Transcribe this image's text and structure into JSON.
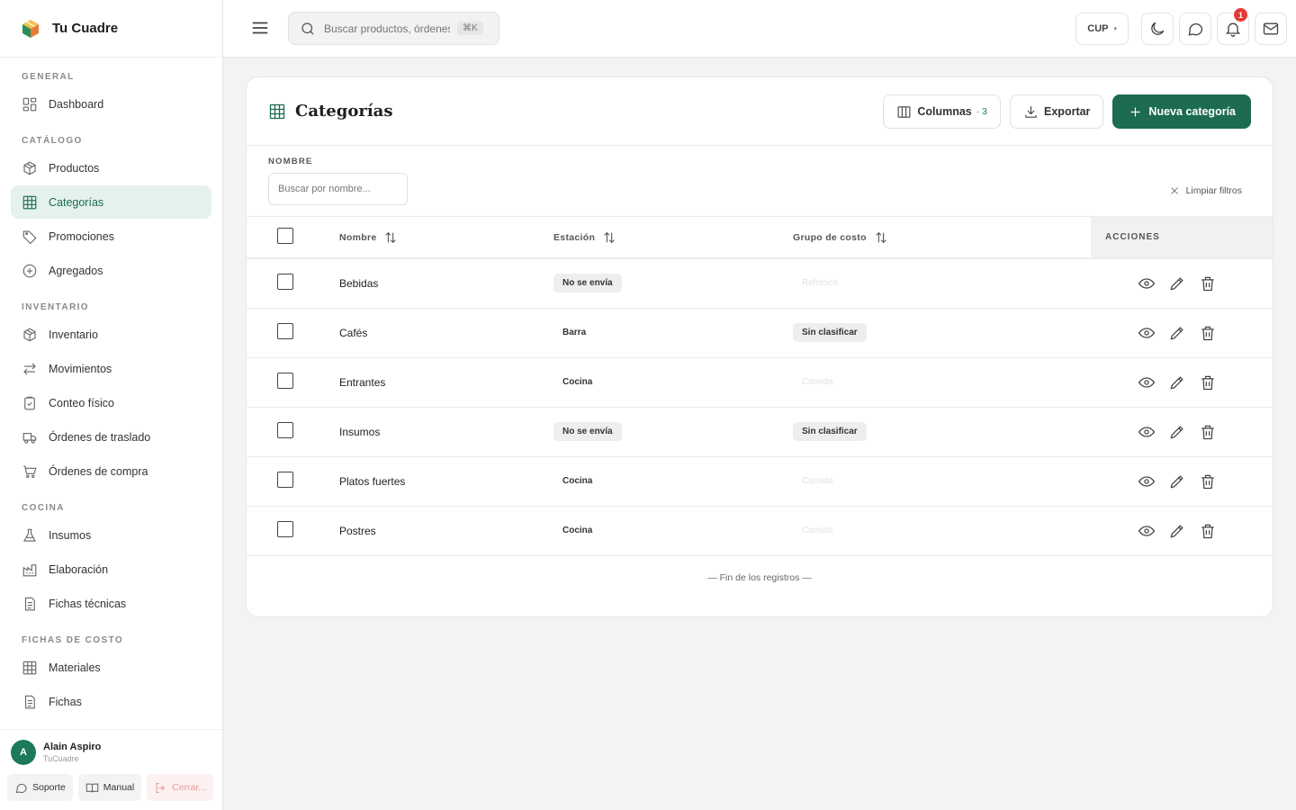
{
  "brand": {
    "name": "Tu Cuadre"
  },
  "sidebar": {
    "sections": [
      {
        "title": "GENERAL",
        "items": [
          {
            "label": "Dashboard",
            "icon": "dashboard-icon"
          }
        ]
      },
      {
        "title": "CATÁLOGO",
        "items": [
          {
            "label": "Productos",
            "icon": "box-icon"
          },
          {
            "label": "Categorías",
            "icon": "grid-icon",
            "active": true
          },
          {
            "label": "Promociones",
            "icon": "tag-icon"
          },
          {
            "label": "Agregados",
            "icon": "plus-circle-icon"
          }
        ]
      },
      {
        "title": "INVENTARIO",
        "items": [
          {
            "label": "Inventario",
            "icon": "box-icon"
          },
          {
            "label": "Movimientos",
            "icon": "arrows-icon"
          },
          {
            "label": "Conteo físico",
            "icon": "clipboard-icon"
          },
          {
            "label": "Órdenes de traslado",
            "icon": "truck-icon"
          },
          {
            "label": "Órdenes de compra",
            "icon": "cart-icon"
          }
        ]
      },
      {
        "title": "COCINA",
        "items": [
          {
            "label": "Insumos",
            "icon": "flask-icon"
          },
          {
            "label": "Elaboración",
            "icon": "factory-icon"
          },
          {
            "label": "Fichas técnicas",
            "icon": "document-icon"
          }
        ]
      },
      {
        "title": "FICHAS DE COSTO",
        "items": [
          {
            "label": "Materiales",
            "icon": "grid-icon"
          },
          {
            "label": "Fichas",
            "icon": "document-icon"
          }
        ]
      }
    ]
  },
  "user": {
    "initial": "A",
    "name": "Alain Aspiro",
    "org": "TuCuadre"
  },
  "footer": {
    "support": "Soporte",
    "manual": "Manual",
    "logout": "Cerrar..."
  },
  "topbar": {
    "search_placeholder": "Buscar productos, órdenes...",
    "shortcut": "⌘K",
    "currency": "CUP",
    "notifications": "1"
  },
  "page": {
    "title": "Categorías",
    "columns_label": "Columnas",
    "columns_count": "· 3",
    "export_label": "Exportar",
    "new_label": "Nueva categoría"
  },
  "filters": {
    "name_label": "NOMBRE",
    "name_placeholder": "Buscar por nombre...",
    "clear_label": "Limpiar filtros"
  },
  "table": {
    "headers": {
      "name": "Nombre",
      "station": "Estación",
      "cost_group": "Grupo de costo",
      "actions": "ACCIONES"
    },
    "rows": [
      {
        "name": "Bebidas",
        "station": "No se envía",
        "station_style": "gray",
        "cost_group": "Refresco",
        "cost_style": "faded"
      },
      {
        "name": "Cafés",
        "station": "Barra",
        "station_style": "plain",
        "cost_group": "Sin clasificar",
        "cost_style": "gray"
      },
      {
        "name": "Entrantes",
        "station": "Cocina",
        "station_style": "plain",
        "cost_group": "Comida",
        "cost_style": "faded"
      },
      {
        "name": "Insumos",
        "station": "No se envía",
        "station_style": "gray",
        "cost_group": "Sin clasificar",
        "cost_style": "gray"
      },
      {
        "name": "Platos fuertes",
        "station": "Cocina",
        "station_style": "plain",
        "cost_group": "Comida",
        "cost_style": "faded"
      },
      {
        "name": "Postres",
        "station": "Cocina",
        "station_style": "plain",
        "cost_group": "Comida",
        "cost_style": "faded"
      }
    ],
    "end_text": "— Fin de los registros —"
  },
  "colors": {
    "accent": "#1c6b52",
    "active_bg": "#e5f1ec",
    "badge": "#e53935"
  }
}
